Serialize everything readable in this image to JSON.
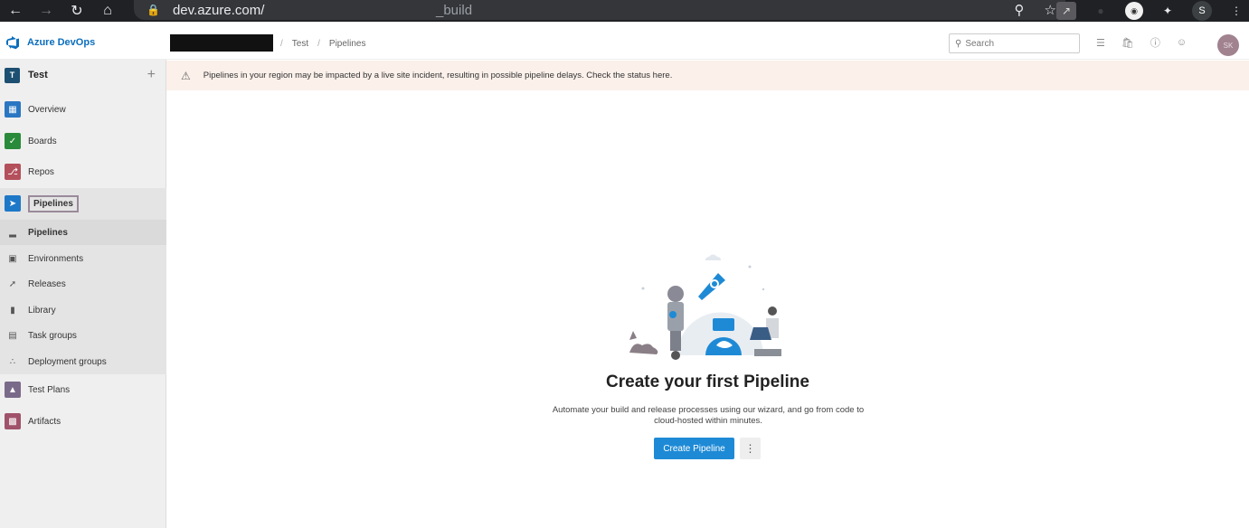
{
  "browser": {
    "url_host": "dev.azure.com/",
    "url_path": "_build",
    "profile_initial": "S",
    "icons": [
      "back-arrow-icon",
      "forward-arrow-icon",
      "reload-icon",
      "home-icon",
      "lock-icon",
      "zoom-icon",
      "star-icon",
      "pdf-extension-icon",
      "extension-icon",
      "circle-extension-icon",
      "puzzle-icon",
      "profile-icon",
      "menu-icon"
    ]
  },
  "header": {
    "product": "Azure DevOps",
    "breadcrumbs": [
      "Test",
      "Pipelines"
    ],
    "search_placeholder": "Search",
    "avatar_initials": "SK"
  },
  "sidebar": {
    "project": {
      "tile": "T",
      "name": "Test"
    },
    "items": [
      {
        "label": "Overview"
      },
      {
        "label": "Boards"
      },
      {
        "label": "Repos"
      },
      {
        "label": "Pipelines"
      }
    ],
    "sub_items": [
      {
        "label": "Pipelines"
      },
      {
        "label": "Environments"
      },
      {
        "label": "Releases"
      },
      {
        "label": "Library"
      },
      {
        "label": "Task groups"
      },
      {
        "label": "Deployment groups"
      }
    ],
    "bottom_items": [
      {
        "label": "Test Plans"
      },
      {
        "label": "Artifacts"
      }
    ]
  },
  "banner": {
    "text": "Pipelines in your region may be impacted by a live site incident, resulting in possible pipeline delays. Check the status here."
  },
  "main": {
    "title": "Create your first Pipeline",
    "description": "Automate your build and release processes using our wizard, and go from code to cloud-hosted within minutes.",
    "create_button": "Create Pipeline"
  },
  "colors": {
    "accent": "#1e8ad6",
    "brand": "#0a6ebd",
    "banner_bg": "#fbf0ea"
  }
}
